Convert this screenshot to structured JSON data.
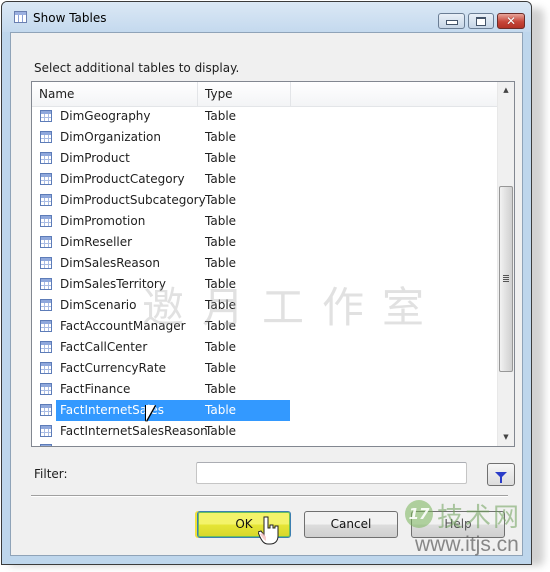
{
  "window": {
    "title": "Show Tables",
    "controls": {
      "minimize": "minimize",
      "maximize": "maximize",
      "close": "close"
    }
  },
  "instruction": "Select additional tables to display.",
  "list": {
    "columns": {
      "name": "Name",
      "type": "Type"
    },
    "rows": [
      {
        "name": "DimGeography",
        "type": "Table",
        "selected": false
      },
      {
        "name": "DimOrganization",
        "type": "Table",
        "selected": false
      },
      {
        "name": "DimProduct",
        "type": "Table",
        "selected": false
      },
      {
        "name": "DimProductCategory",
        "type": "Table",
        "selected": false
      },
      {
        "name": "DimProductSubcategory",
        "type": "Table",
        "selected": false
      },
      {
        "name": "DimPromotion",
        "type": "Table",
        "selected": false
      },
      {
        "name": "DimReseller",
        "type": "Table",
        "selected": false
      },
      {
        "name": "DimSalesReason",
        "type": "Table",
        "selected": false
      },
      {
        "name": "DimSalesTerritory",
        "type": "Table",
        "selected": false
      },
      {
        "name": "DimScenario",
        "type": "Table",
        "selected": false
      },
      {
        "name": "FactAccountManager",
        "type": "Table",
        "selected": false
      },
      {
        "name": "FactCallCenter",
        "type": "Table",
        "selected": false
      },
      {
        "name": "FactCurrencyRate",
        "type": "Table",
        "selected": false
      },
      {
        "name": "FactFinance",
        "type": "Table",
        "selected": false
      },
      {
        "name": "FactInternetSales",
        "type": "Table",
        "selected": true
      },
      {
        "name": "FactInternetSalesReason",
        "type": "Table",
        "selected": false
      }
    ],
    "selection_color": "#3399ff"
  },
  "filter": {
    "label": "Filter:",
    "value": "",
    "placeholder": ""
  },
  "buttons": {
    "ok": "OK",
    "cancel": "Cancel",
    "help": "Help"
  },
  "watermarks": {
    "center": "邀月工作室",
    "logo_badge": "17",
    "logo_text": "技术网",
    "logo_url": "www.itjs.cn"
  },
  "icons": {
    "title": "table-grid-icon",
    "row": "table-grid-icon",
    "filter": "funnel-icon",
    "scroll_up": "▲",
    "scroll_down": "▼"
  }
}
